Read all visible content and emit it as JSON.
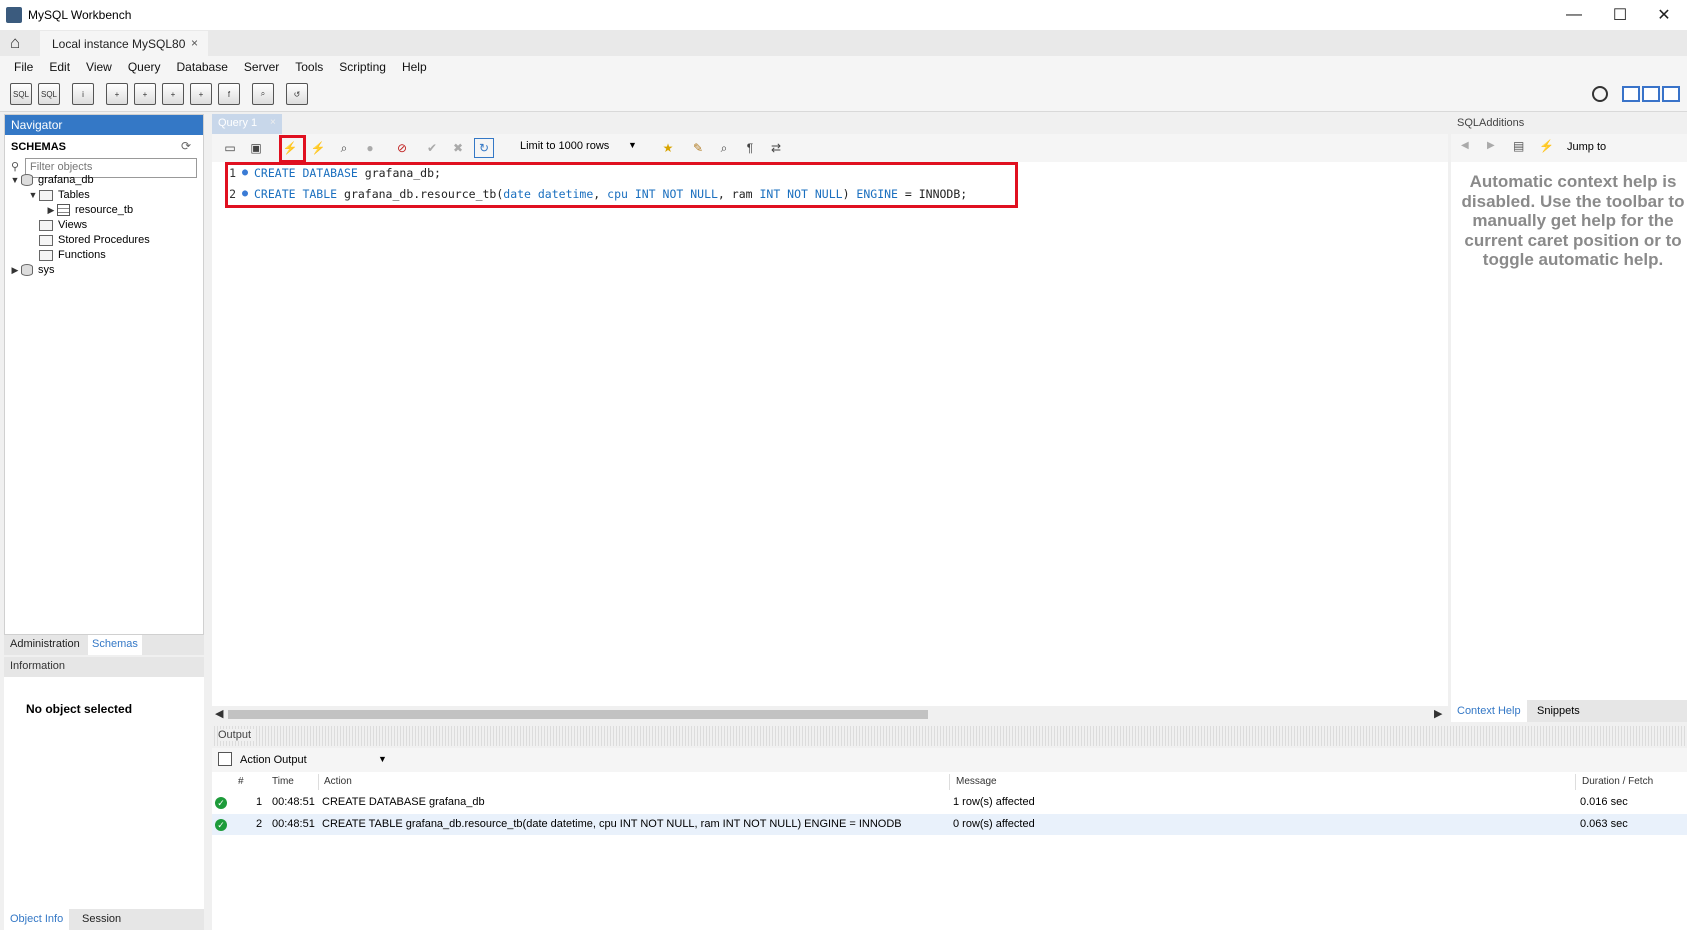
{
  "window": {
    "title": "MySQL Workbench",
    "minimize": "—",
    "maximize": "☐",
    "close": "✕"
  },
  "connection_tab": {
    "label": "Local instance MySQL80",
    "close": "×"
  },
  "menu": [
    "File",
    "Edit",
    "View",
    "Query",
    "Database",
    "Server",
    "Tools",
    "Scripting",
    "Help"
  ],
  "navigator": {
    "title": "Navigator",
    "schemas_label": "SCHEMAS",
    "filter_placeholder": "Filter objects",
    "tree": [
      {
        "label": "grafana_db"
      },
      {
        "label": "Tables"
      },
      {
        "label": "resource_tb"
      },
      {
        "label": "Views"
      },
      {
        "label": "Stored Procedures"
      },
      {
        "label": "Functions"
      },
      {
        "label": "sys"
      }
    ],
    "tabs": [
      "Administration",
      "Schemas"
    ]
  },
  "information": {
    "title": "Information",
    "message": "No object selected"
  },
  "bottom_tabs": [
    "Object Info",
    "Session"
  ],
  "query_tab": {
    "label": "Query 1",
    "close": "×"
  },
  "editor_toolbar": {
    "limit_label": "Limit to 1000 rows"
  },
  "editor": {
    "lines": [
      {
        "num": "1",
        "parts": [
          {
            "t": "CREATE DATABASE",
            "k": "kw"
          },
          {
            "t": " grafana_db;",
            "k": "tx"
          }
        ]
      },
      {
        "num": "2",
        "parts": [
          {
            "t": "CREATE TABLE",
            "k": "kw"
          },
          {
            "t": " grafana_db.resource_tb(",
            "k": "tx"
          },
          {
            "t": "date datetime",
            "k": "kw"
          },
          {
            "t": ", ",
            "k": "tx"
          },
          {
            "t": "cpu INT NOT NULL",
            "k": "kw"
          },
          {
            "t": ", ram ",
            "k": "tx"
          },
          {
            "t": "INT NOT NULL",
            "k": "kw"
          },
          {
            "t": ") ",
            "k": "tx"
          },
          {
            "t": "ENGINE",
            "k": "kw"
          },
          {
            "t": " = INNODB;",
            "k": "tx"
          }
        ]
      }
    ]
  },
  "sql_additions": {
    "title": "SQLAdditions",
    "jump_to": "Jump to",
    "help_text": "Automatic context help is disabled. Use the toolbar to manually get help for the current caret position or to toggle automatic help.",
    "tabs": [
      "Context Help",
      "Snippets"
    ]
  },
  "output": {
    "title": "Output",
    "selector": "Action Output",
    "columns": [
      "#",
      "Time",
      "Action",
      "Message",
      "Duration / Fetch"
    ],
    "rows": [
      {
        "num": "1",
        "time": "00:48:51",
        "action": "CREATE DATABASE grafana_db",
        "message": "1 row(s) affected",
        "duration": "0.016 sec"
      },
      {
        "num": "2",
        "time": "00:48:51",
        "action": "CREATE TABLE grafana_db.resource_tb(date datetime, cpu INT NOT NULL, ram INT NOT NULL) ENGINE = INNODB",
        "message": "0 row(s) affected",
        "duration": "0.063 sec"
      }
    ]
  },
  "colors": {
    "accent": "#3478c6",
    "highlight": "#e01020",
    "keyword": "#1a6fbf",
    "success": "#1d9b3a"
  }
}
